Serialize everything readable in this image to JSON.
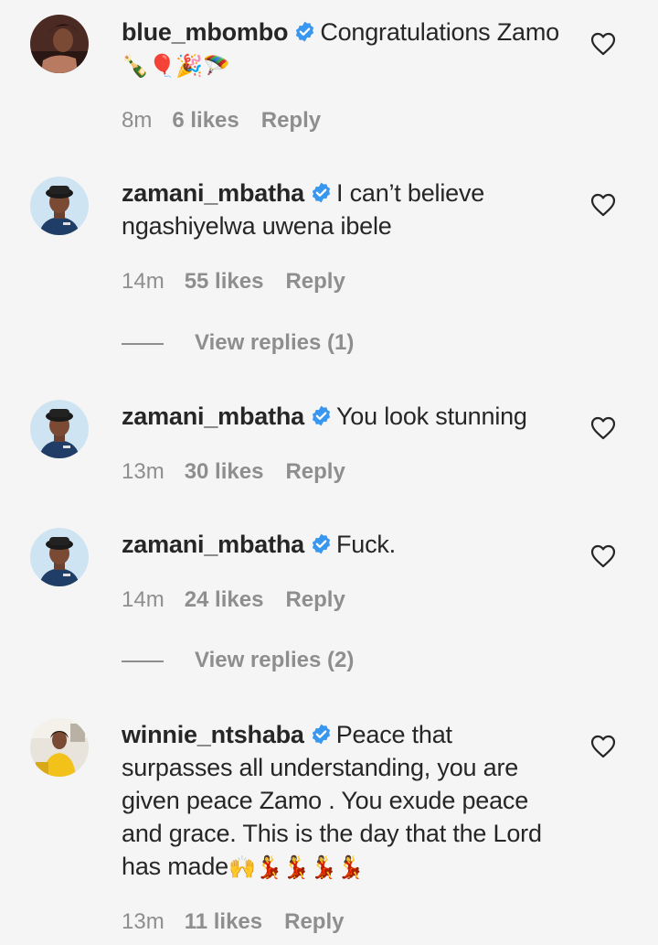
{
  "comments": [
    {
      "username": "blue_mbombo",
      "text": "Congratulations Zamo",
      "emoji": "🍾🎈🎉🪂",
      "time": "8m",
      "likes": "6 likes",
      "reply": "Reply",
      "avatar": "profile-photo-woman"
    },
    {
      "username": "zamani_mbatha",
      "text": "I can’t believe ngashiyelwa uwena ibele",
      "time": "14m",
      "likes": "55 likes",
      "reply": "Reply",
      "view_replies": "View replies (1)",
      "avatar": "profile-photo-man-hat"
    },
    {
      "username": "zamani_mbatha",
      "text": "You look stunning",
      "time": "13m",
      "likes": "30 likes",
      "reply": "Reply",
      "avatar": "profile-photo-man-hat"
    },
    {
      "username": "zamani_mbatha",
      "text": "Fuck.",
      "time": "14m",
      "likes": "24 likes",
      "reply": "Reply",
      "view_replies": "View replies (2)",
      "avatar": "profile-photo-man-hat"
    },
    {
      "username": "winnie_ntshaba",
      "text": "Peace that surpasses all understanding, you are given peace Zamo . You exude peace and grace. This is the day that the Lord has made",
      "emoji": "🙌💃💃💃💃",
      "time": "13m",
      "likes": "11 likes",
      "reply": "Reply",
      "avatar": "profile-photo-woman-yellow"
    }
  ],
  "colors": {
    "background": "#f5f5f5",
    "verified_badge": "#3897f0",
    "secondary_text": "#8e8e8e",
    "primary_text": "#262626"
  },
  "icons": {
    "verified": "verified-badge-icon",
    "like": "heart-outline-icon"
  }
}
